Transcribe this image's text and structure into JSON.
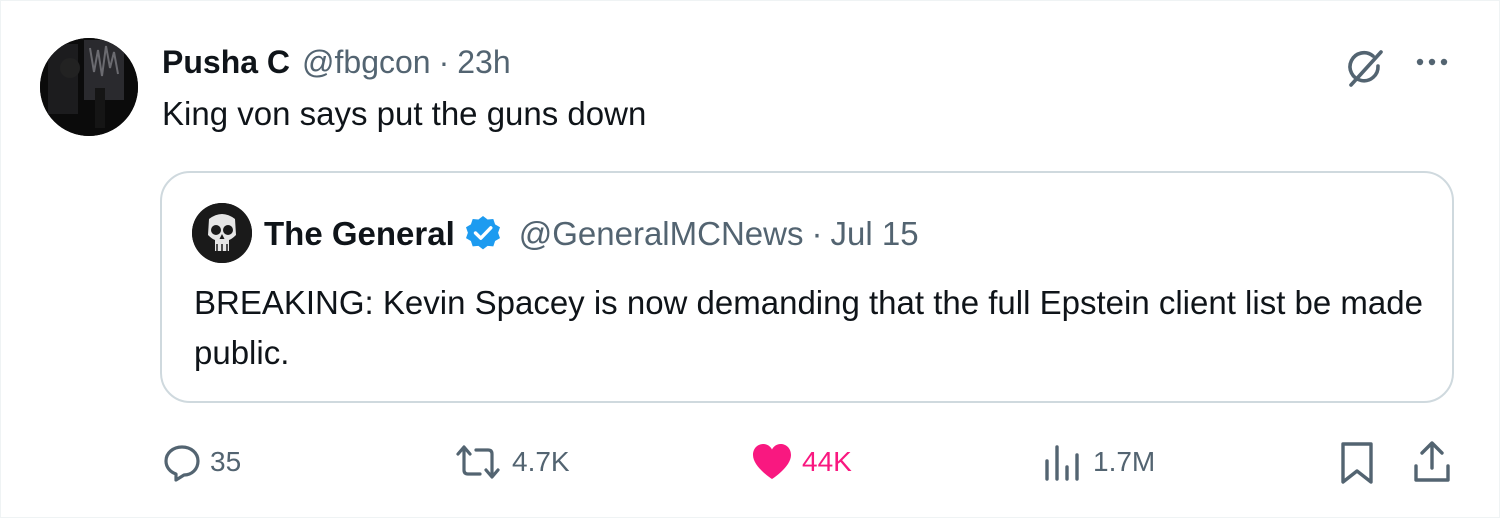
{
  "tweet": {
    "author_name": "Pusha C",
    "author_handle": "@fbgcon",
    "separator": "·",
    "time": "23h",
    "text": "King von says put the guns down"
  },
  "quoted": {
    "author_name": "The General",
    "author_handle": "@GeneralMCNews",
    "separator": "·",
    "time": "Jul 15",
    "text": "BREAKING: Kevin Spacey is now demanding that the full Epstein client list be made public.",
    "verified": true
  },
  "actions": {
    "replies": "35",
    "reposts": "4.7K",
    "likes": "44K",
    "views": "1.7M"
  },
  "icons": [
    "grok-icon",
    "more-icon",
    "reply-icon",
    "repost-icon",
    "heart-icon",
    "views-icon",
    "bookmark-icon",
    "share-icon",
    "verified-badge-icon"
  ],
  "colors": {
    "text": "#0f1419",
    "secondary": "#536471",
    "like": "#f91880",
    "verified": "#1d9bf0",
    "border": "#cfd9de"
  }
}
